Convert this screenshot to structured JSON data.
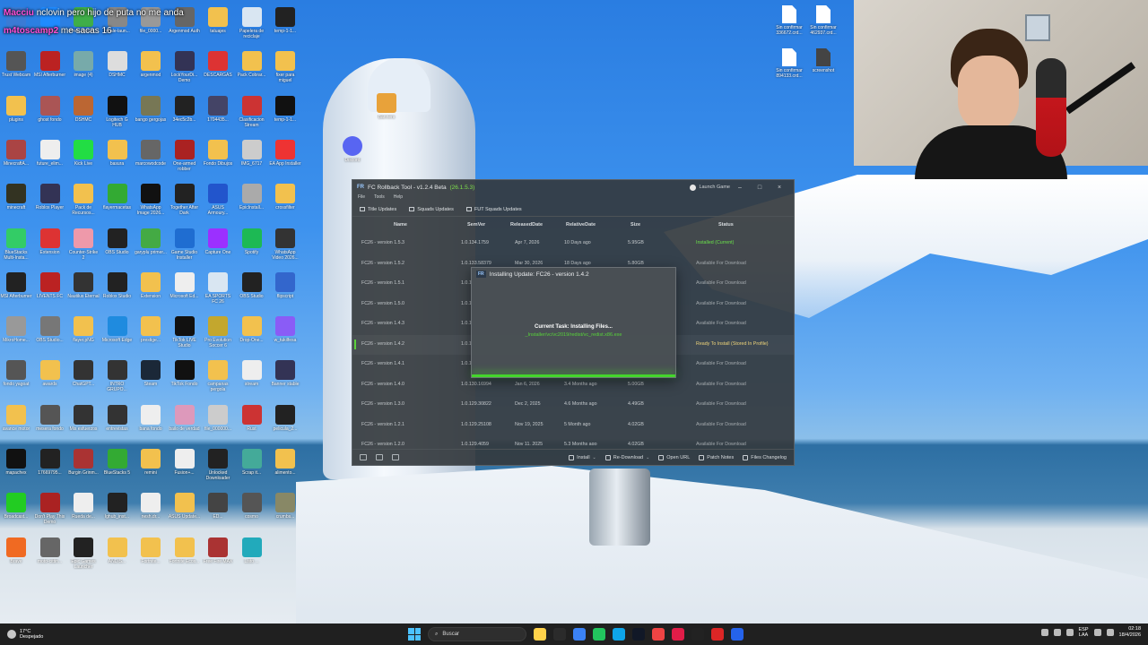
{
  "chat": {
    "line1_name": "Macciu",
    "line1_text": "nclovin pero hijo de puta no me anda",
    "line2_name": "m4toscamp2",
    "line2_text": "me sacas 16"
  },
  "desktop_icons": [
    {
      "label": "",
      "color": "#3a7bd5"
    },
    {
      "label": "Wemod",
      "color": "#1f8bff"
    },
    {
      "label": "Free Green...",
      "color": "#3fae49"
    },
    {
      "label": "hytale-laun...",
      "color": "#888"
    },
    {
      "label": "file_0000...",
      "color": "#999"
    },
    {
      "label": "Argenmod Auth",
      "color": "#666"
    },
    {
      "label": "tatuajes",
      "color": "#f2c14e"
    },
    {
      "label": "Papelera de reciclaje",
      "color": "#d9e6f2"
    },
    {
      "label": "temp-1-1...",
      "color": "#222"
    },
    {
      "label": "Trust Webcam",
      "color": "#555"
    },
    {
      "label": "MSI Afterburner",
      "color": "#b22"
    },
    {
      "label": "image (4)",
      "color": "#7aa"
    },
    {
      "label": "DSHMC",
      "color": "#ddd"
    },
    {
      "label": "argenmod",
      "color": "#f2c14e"
    },
    {
      "label": "LockYourDi... Demo",
      "color": "#335"
    },
    {
      "label": "DESCARGAS",
      "color": "#d33"
    },
    {
      "label": "Pack Cobrar...",
      "color": "#f2c14e"
    },
    {
      "label": "fixer para miguel",
      "color": "#f2c14e"
    },
    {
      "label": "plugins",
      "color": "#f2c14e"
    },
    {
      "label": "ghost fondo",
      "color": "#a55"
    },
    {
      "label": "DSHMC",
      "color": "#b63"
    },
    {
      "label": "Logitech G HUB",
      "color": "#111"
    },
    {
      "label": "bango gergojas",
      "color": "#775"
    },
    {
      "label": "34ec5c2b...",
      "color": "#222"
    },
    {
      "label": "1704435...",
      "color": "#446"
    },
    {
      "label": "Clasificacion Stream",
      "color": "#c33"
    },
    {
      "label": "temp-1-1...",
      "color": "#111"
    },
    {
      "label": "MinecraftA...",
      "color": "#a44"
    },
    {
      "label": "future_elim...",
      "color": "#eee"
    },
    {
      "label": "Kick Live",
      "color": "#22dd44"
    },
    {
      "label": "basura",
      "color": "#f2c14e"
    },
    {
      "label": "marcowodcode",
      "color": "#666"
    },
    {
      "label": "One-armed robber",
      "color": "#a22"
    },
    {
      "label": "Fondo Dibujos",
      "color": "#f2c14e"
    },
    {
      "label": "IMG_6717",
      "color": "#ccc"
    },
    {
      "label": "EA App Installer",
      "color": "#e33"
    },
    {
      "label": "minecraft",
      "color": "#332"
    },
    {
      "label": "Roblox Player",
      "color": "#335"
    },
    {
      "label": "Pack de Recursos...",
      "color": "#f2c14e"
    },
    {
      "label": "flayermacetas",
      "color": "#3a3"
    },
    {
      "label": "WhatsApp Image 2026...",
      "color": "#111"
    },
    {
      "label": "Together After Dark",
      "color": "#222"
    },
    {
      "label": "ASUS Armoury...",
      "color": "#2255cc"
    },
    {
      "label": "EpicInstall...",
      "color": "#aaa"
    },
    {
      "label": "crossfilter",
      "color": "#f2c14e"
    },
    {
      "label": "BlueStacks Multi-Insta...",
      "color": "#3c6"
    },
    {
      "label": "Extension",
      "color": "#d33"
    },
    {
      "label": "Counter-Strike 2",
      "color": "#e9a"
    },
    {
      "label": "OBS Studio",
      "color": "#222"
    },
    {
      "label": "garyplu primer...",
      "color": "#4a4"
    },
    {
      "label": "Game Studio Installer",
      "color": "#1f6dd1"
    },
    {
      "label": "Capture One",
      "color": "#9b30ff"
    },
    {
      "label": "Spotify",
      "color": "#1db954"
    },
    {
      "label": "WhatsApp Video 2026...",
      "color": "#333"
    },
    {
      "label": "MSI Afterburner",
      "color": "#222"
    },
    {
      "label": "LIVENTS FC",
      "color": "#b22"
    },
    {
      "label": "Nautilus Eternal",
      "color": "#333"
    },
    {
      "label": "Roblox Studio",
      "color": "#222"
    },
    {
      "label": "Extension",
      "color": "#f2c14e"
    },
    {
      "label": "Microsoft Ed...",
      "color": "#eee"
    },
    {
      "label": "EA SPORTS FC 26",
      "color": "#d9e6f2"
    },
    {
      "label": "OBS Studio",
      "color": "#222"
    },
    {
      "label": "flipscript",
      "color": "#36c"
    },
    {
      "label": "MikroHome...",
      "color": "#999"
    },
    {
      "label": "OBS Studio...",
      "color": "#777"
    },
    {
      "label": "flayer.pNG",
      "color": "#f2c14e"
    },
    {
      "label": "Microsoft Edge",
      "color": "#1f8bdf"
    },
    {
      "label": "prestige...",
      "color": "#f2c14e"
    },
    {
      "label": "TikTok LIVE Studio",
      "color": "#111"
    },
    {
      "label": "Pro Evolution Soccer 6",
      "color": "#c3a72e"
    },
    {
      "label": "Drop-One...",
      "color": "#f2c14e"
    },
    {
      "label": "w_tukilfesa",
      "color": "#8a5cf6"
    },
    {
      "label": "fondo yagoat",
      "color": "#555"
    },
    {
      "label": "awards",
      "color": "#f2c14e"
    },
    {
      "label": "ChatGPT...",
      "color": "#333"
    },
    {
      "label": "INTRO GRUPO...",
      "color": "#333"
    },
    {
      "label": "Steam",
      "color": "#1b2838"
    },
    {
      "label": "TikTok Fondo",
      "color": "#111"
    },
    {
      "label": "campanas pergola",
      "color": "#f2c14e"
    },
    {
      "label": "stream",
      "color": "#eee"
    },
    {
      "label": "Banner stable",
      "color": "#335"
    },
    {
      "label": "avance motor",
      "color": "#f2c14e"
    },
    {
      "label": "mesera fondo",
      "color": "#555"
    },
    {
      "label": "Mis esfuerzos",
      "color": "#333"
    },
    {
      "label": "entrevistas",
      "color": "#333"
    },
    {
      "label": "bana fondo",
      "color": "#eee"
    },
    {
      "label": "bailo de verdad",
      "color": "#d9b"
    },
    {
      "label": "file_000000...",
      "color": "#ccc"
    },
    {
      "label": "Rust",
      "color": "#c33"
    },
    {
      "label": "pelicula_2...",
      "color": "#222"
    },
    {
      "label": "mapachex",
      "color": "#111"
    },
    {
      "label": "17669795...",
      "color": "#222"
    },
    {
      "label": "Burgin Grinm...",
      "color": "#a33"
    },
    {
      "label": "BlueStacks 5",
      "color": "#3a3"
    },
    {
      "label": "remini",
      "color": "#f2c14e"
    },
    {
      "label": "Fusion+...",
      "color": "#eee"
    },
    {
      "label": "Unlocked Downloader",
      "color": "#222"
    },
    {
      "label": "Scrap it...",
      "color": "#4a9"
    },
    {
      "label": "alimento...",
      "color": "#f2c14e"
    },
    {
      "label": "Broadcast...",
      "color": "#2c2"
    },
    {
      "label": "Don't Play This Demo",
      "color": "#a22"
    },
    {
      "label": "Rueda de...",
      "color": "#eee"
    },
    {
      "label": "lghub_inst...",
      "color": "#222"
    },
    {
      "label": "nesh.dr...",
      "color": "#eee"
    },
    {
      "label": "ASUS Update...",
      "color": "#f2c14e"
    },
    {
      "label": "ED...",
      "color": "#444"
    },
    {
      "label": "cosmo",
      "color": "#555"
    },
    {
      "label": "crumbs...",
      "color": "#886"
    },
    {
      "label": "Brave",
      "color": "#f06a22"
    },
    {
      "label": "moto-cittin...",
      "color": "#666"
    },
    {
      "label": "Epic Games Launcher",
      "color": "#222"
    },
    {
      "label": "ANDIS...",
      "color": "#f2c14e"
    },
    {
      "label": "Fortnite...",
      "color": "#f2c14e"
    },
    {
      "label": "Fortnite Ecos...",
      "color": "#f2c14e"
    },
    {
      "label": "Free Fire MAX",
      "color": "#a33"
    },
    {
      "label": "Listo ...",
      "color": "#2ab"
    }
  ],
  "top_files": [
    {
      "label": "Sin confirmar 336672.crd..."
    },
    {
      "label": "Sin confirmar 462937.crd..."
    },
    {
      "label": "Sin confirmar 894133.crd..."
    },
    {
      "label": "screenshot"
    }
  ],
  "misc_icons": {
    "banners_label": "Banners",
    "discord_label": "Discord"
  },
  "app": {
    "logo": "FR",
    "title": "FC Rollback Tool - v1.2.4 Beta",
    "version_badge": "(26.1.5.3)",
    "launch_label": "Launch Game",
    "menu": [
      "File",
      "Tools",
      "Help"
    ],
    "tabs": [
      "Title Updates",
      "Squads Updates",
      "FUT Squads Updates"
    ],
    "columns": [
      "Name",
      "SemVer",
      "ReleasedDate",
      "RelativeDate",
      "Size",
      "Status"
    ],
    "rows": [
      {
        "name": "FC26 - version 1.5.3",
        "semver": "1.0.134.1759",
        "released": "Apr 7, 2026",
        "relative": "10 Days ago",
        "size": "5.95GB",
        "status": "Installed (Current)",
        "status_type": "installed"
      },
      {
        "name": "FC26 - version 1.5.2",
        "semver": "1.0.133.58379",
        "released": "Mar 30, 2026",
        "relative": "18 Days ago",
        "size": "5.80GB",
        "status": "Available For Download",
        "status_type": "avail"
      },
      {
        "name": "FC26 - version 1.5.1",
        "semver": "1.0.1",
        "released": "",
        "relative": "",
        "size": "",
        "status": "Available For Download",
        "status_type": "avail"
      },
      {
        "name": "FC26 - version 1.5.0",
        "semver": "1.0.1",
        "released": "",
        "relative": "",
        "size": "",
        "status": "Available For Download",
        "status_type": "avail"
      },
      {
        "name": "FC26 - version 1.4.3",
        "semver": "1.0.1",
        "released": "",
        "relative": "",
        "size": "",
        "status": "Available For Download",
        "status_type": "avail"
      },
      {
        "name": "FC26 - version 1.4.2",
        "semver": "1.0.1",
        "released": "",
        "relative": "",
        "size": "",
        "status": "Ready To Install (Stored In Profile)",
        "status_type": "ready",
        "selected": true
      },
      {
        "name": "FC26 - version 1.4.1",
        "semver": "1.0.1",
        "released": "",
        "relative": "",
        "size": "",
        "status": "Available For Download",
        "status_type": "avail"
      },
      {
        "name": "FC26 - version 1.4.0",
        "semver": "1.0.130.16994",
        "released": "Jan 6, 2026",
        "relative": "3.4 Months ago",
        "size": "5.00GB",
        "status": "Available For Download",
        "status_type": "avail"
      },
      {
        "name": "FC26 - version 1.3.0",
        "semver": "1.0.129.30822",
        "released": "Dec 2, 2025",
        "relative": "4.6 Months ago",
        "size": "4.49GB",
        "status": "Available For Download",
        "status_type": "avail"
      },
      {
        "name": "FC26 - version 1.2.1",
        "semver": "1.0.129.25108",
        "released": "Nov 19, 2025",
        "relative": "5 Month ago",
        "size": "4.02GB",
        "status": "Available For Download",
        "status_type": "avail"
      },
      {
        "name": "FC26 - version 1.2.0",
        "semver": "1.0.129.4059",
        "released": "Nov 11, 2025",
        "relative": "5.3 Months ago",
        "size": "4.02GB",
        "status": "Available For Download",
        "status_type": "avail"
      }
    ],
    "bottom_buttons": [
      "Install",
      "Re-Download",
      "Open URL",
      "Patch Notes",
      "Files Changelog"
    ]
  },
  "dialog": {
    "title": "Installing Update: FC26 - version 1.4.2",
    "task": "Current Task: Installing Files...",
    "file": "_Installer/vc/vc2019/redist/vc_redist.x86.exe",
    "progress": 1.0
  },
  "taskbar": {
    "temp": "17°C",
    "weather": "Despejado",
    "search_placeholder": "Buscar",
    "lang_top": "ESP",
    "lang_bottom": "LAA",
    "time": "02:18",
    "date": "18/4/2026",
    "apps": [
      "#ffd24a",
      "#2b2b2b",
      "#3b82f6",
      "#22c55e",
      "#0ea5e9",
      "#111827",
      "#ef4444",
      "#e11d48",
      "#222",
      "#dc2626",
      "#2563eb"
    ]
  }
}
